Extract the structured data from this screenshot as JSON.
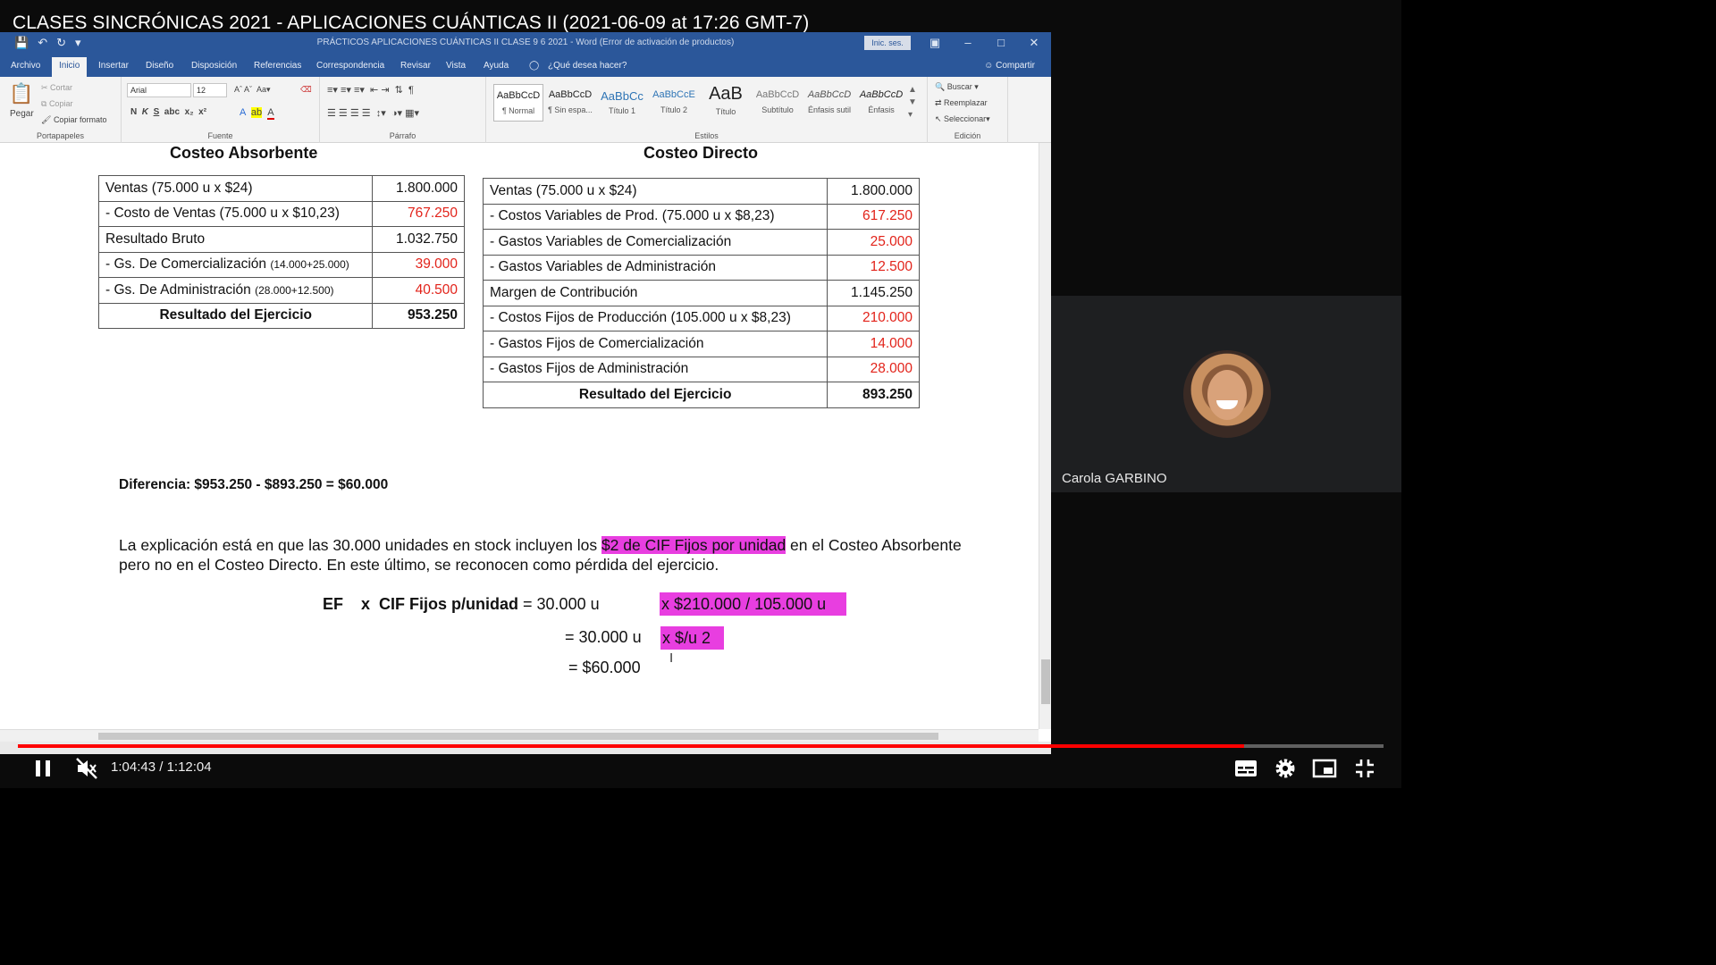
{
  "video": {
    "title": "CLASES SINCRÓNICAS 2021 - APLICACIONES CUÁNTICAS II (2021-06-09 at 17:26 GMT-7)",
    "time_current": "1:04:43",
    "time_separator": "/",
    "time_total": "1:12:04",
    "progress_fraction": 0.898
  },
  "word": {
    "doc_title": "PRÁCTICOS APLICACIONES CUÁNTICAS II  CLASE 9 6 2021  -  Word (Error de activación de productos)",
    "signin": "Inic. ses.",
    "tabs": [
      "Archivo",
      "Inicio",
      "Insertar",
      "Diseño",
      "Disposición",
      "Referencias",
      "Correspondencia",
      "Revisar",
      "Vista",
      "Ayuda"
    ],
    "tell_me": "¿Qué desea hacer?",
    "share": "Compartir",
    "clipboard": {
      "paste": "Pegar",
      "cut": "Cortar",
      "copy": "Copiar",
      "format_painter": "Copiar formato",
      "label": "Portapapeles"
    },
    "font": {
      "name": "Arial",
      "size": "12",
      "label": "Fuente"
    },
    "paragraph_label": "Párrafo",
    "styles": [
      {
        "preview": "AaBbCcD",
        "name": "¶ Normal"
      },
      {
        "preview": "AaBbCcD",
        "name": "¶ Sin espa..."
      },
      {
        "preview": "AaBbCc",
        "name": "Título 1"
      },
      {
        "preview": "AaBbCcE",
        "name": "Título 2"
      },
      {
        "preview": "AaB",
        "name": "Título"
      },
      {
        "preview": "AaBbCcD",
        "name": "Subtítulo"
      },
      {
        "preview": "AaBbCcD",
        "name": "Énfasis sutil"
      },
      {
        "preview": "AaBbCcD",
        "name": "Énfasis"
      }
    ],
    "styles_label": "Estilos",
    "editing": {
      "find": "Buscar",
      "replace": "Reemplazar",
      "select": "Seleccionar",
      "label": "Edición"
    }
  },
  "absorbente": {
    "title": "Costeo Absorbente",
    "rows": [
      {
        "label": "Ventas (75.000 u x $24)",
        "note": "",
        "value": "1.800.000",
        "red": false
      },
      {
        "label": "- Costo de Ventas (75.000 u x $10,23)",
        "note": "",
        "value": "767.250",
        "red": true
      },
      {
        "label": "Resultado Bruto",
        "note": "",
        "value": "1.032.750",
        "red": false
      },
      {
        "label": "- Gs. De Comercialización ",
        "note": "(14.000+25.000)",
        "value": "39.000",
        "red": true
      },
      {
        "label": "- Gs. De Administración ",
        "note": "(28.000+12.500)",
        "value": "40.500",
        "red": true
      }
    ],
    "result_label": "Resultado del Ejercicio",
    "result_value": "953.250"
  },
  "directo": {
    "title": "Costeo Directo",
    "rows": [
      {
        "label": "Ventas (75.000 u x $24)",
        "value": "1.800.000",
        "red": false
      },
      {
        "label": "- Costos Variables de Prod. (75.000 u x $8,23)",
        "value": "617.250",
        "red": true
      },
      {
        "label": "- Gastos Variables de Comercialización",
        "value": "25.000",
        "red": true
      },
      {
        "label": "- Gastos Variables de Administración",
        "value": "12.500",
        "red": true
      },
      {
        "label": "Margen de Contribución",
        "value": "1.145.250",
        "red": false
      },
      {
        "label": "- Costos Fijos de Producción (105.000 u x $8,23)",
        "value": "210.000",
        "red": true
      },
      {
        "label": "- Gastos Fijos de Comercialización",
        "value": "14.000",
        "red": true
      },
      {
        "label": "- Gastos Fijos de Administración",
        "value": "28.000",
        "red": true
      }
    ],
    "result_label": "Resultado del Ejercicio",
    "result_value": "893.250"
  },
  "difference": "Diferencia: $953.250 - $893.250 = $60.000",
  "explanation": {
    "before": "La explicación está en que las 30.000 unidades en stock incluyen los ",
    "highlight": "$2 de CIF Fijos por unidad",
    "after": " en el Costeo Absorbente pero no en el Costeo Directo. En este último, se reconocen como pérdida del ejercicio."
  },
  "formula": {
    "line1_bold": "EF    x  CIF Fijos p/unidad",
    "line1_rest": " = 30.000 u",
    "line1_hl": "x   $210.000 / 105.000 u",
    "line2": "= 30.000 u",
    "line2_hl": "x   $/u 2",
    "line3": "= $60.000"
  },
  "participant": {
    "name": "Carola GARBINO"
  }
}
